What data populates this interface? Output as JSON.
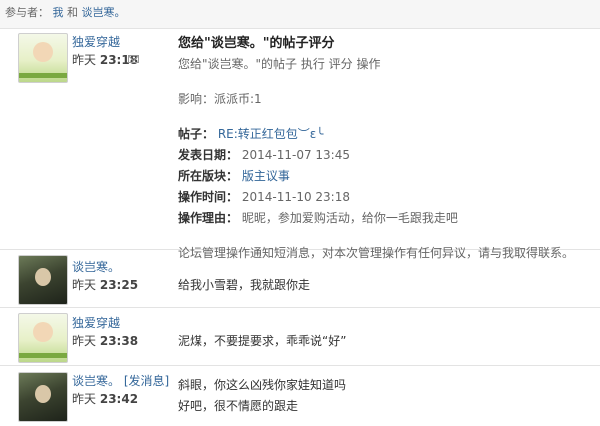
{
  "participants": {
    "label": "参与者：",
    "me": "我",
    "and": "和",
    "other": "谈岂寒。"
  },
  "messages": [
    {
      "author": "独爱穿越",
      "time_prefix": "昨天",
      "time": "23:18",
      "title": "您给\"谈岂寒。\"的帖子评分",
      "subtitle": "您给\"谈岂寒。\"的帖子 执行 评分 操作",
      "effect": "影响：派派币:1",
      "post_label": "帖子：",
      "post_value": "RE:转正红包包︶ε╰",
      "date_label": "发表日期：",
      "date_value": "2014-11-07 13:45",
      "board_label": "所在版块：",
      "board_value": "版主议事",
      "optime_label": "操作时间：",
      "optime_value": "2014-11-10 23:18",
      "reason_label": "操作理由：",
      "reason_value": "昵昵，参加爱购活动，给你一毛跟我走吧",
      "footer": "论坛管理操作通知短消息，对本次管理操作有任何异议，请与我取得联系。"
    },
    {
      "author": "谈岂寒。",
      "time_prefix": "昨天",
      "time": "23:25",
      "text": "给我小雪碧，我就跟你走"
    },
    {
      "author": "独爱穿越",
      "time_prefix": "昨天",
      "time": "23:38",
      "text": "泥煤，不要提要求，乖乖说“好”"
    },
    {
      "author": "谈岂寒。",
      "author_extra": "[发消息]",
      "time_prefix": "昨天",
      "time": "23:42",
      "text1": "斜眼，你这么凶残你家娃知道吗",
      "text2": "好吧，很不情愿的跟走"
    }
  ]
}
